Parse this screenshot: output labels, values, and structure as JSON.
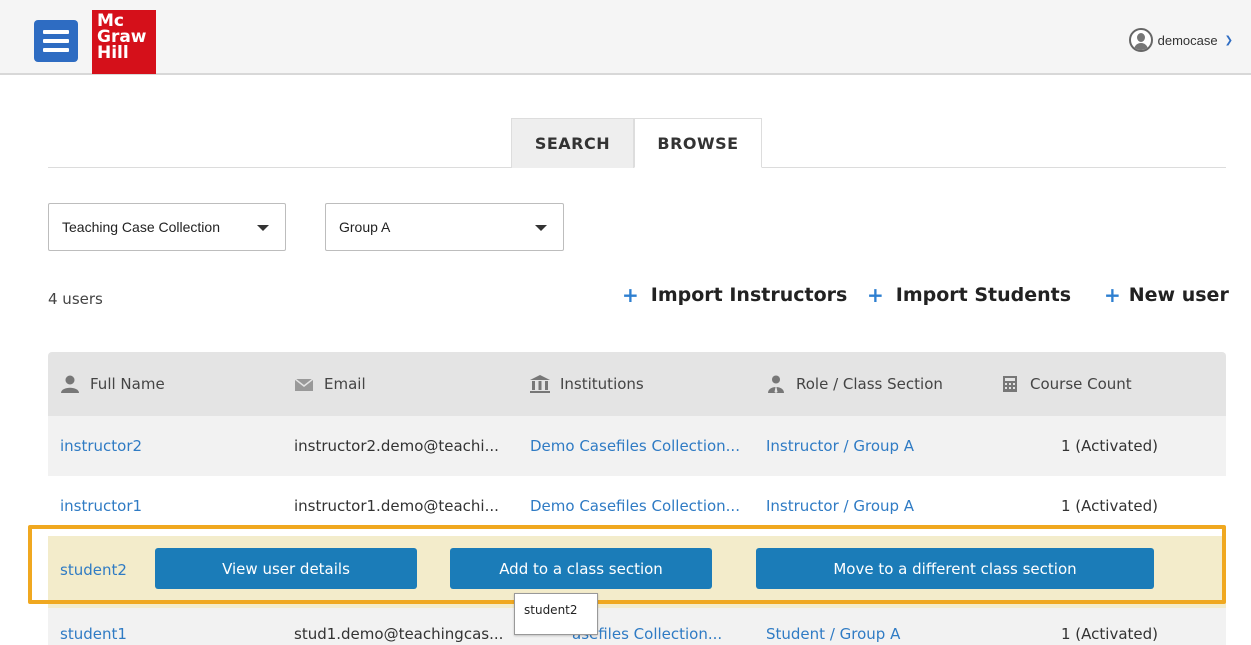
{
  "header": {
    "logo_lines": [
      "Mc",
      "Graw",
      "Hill"
    ],
    "username": "democase"
  },
  "tabs": [
    {
      "label": "SEARCH",
      "active": false
    },
    {
      "label": "BROWSE",
      "active": true
    }
  ],
  "filters": {
    "collection": "Teaching Case Collection",
    "group": "Group A"
  },
  "summary": {
    "user_count": "4 users"
  },
  "actions": {
    "import_instructors": "Import Instructors",
    "import_students": "Import Students",
    "new_user": "New user"
  },
  "table": {
    "columns": [
      "Full Name",
      "Email",
      "Institutions",
      "Role / Class Section",
      "Course Count"
    ],
    "rows": [
      {
        "name": "instructor2",
        "email": "instructor2.demo@teachi...",
        "institution": "Demo Casefiles Collection...",
        "role": "Instructor / Group A",
        "count": "1 (Activated)"
      },
      {
        "name": "instructor1",
        "email": "instructor1.demo@teachi...",
        "institution": "Demo Casefiles Collection...",
        "role": "Instructor / Group A",
        "count": "1 (Activated)"
      },
      {
        "name": "student2"
      },
      {
        "name": "student1",
        "email": "stud1.demo@teachingcas...",
        "institution": "asefiles Collection...",
        "role": "Student / Group A",
        "count": "1 (Activated)"
      }
    ]
  },
  "row_actions": {
    "view_details": "View user details",
    "add_to_section": "Add to a class section",
    "move_section": "Move to a different class section"
  },
  "tooltip": "student2",
  "colors": {
    "primary_button": "#1b7cb8",
    "link": "#2f7bc4",
    "highlight_border": "#f0a820",
    "brand_red": "#d5101a"
  }
}
